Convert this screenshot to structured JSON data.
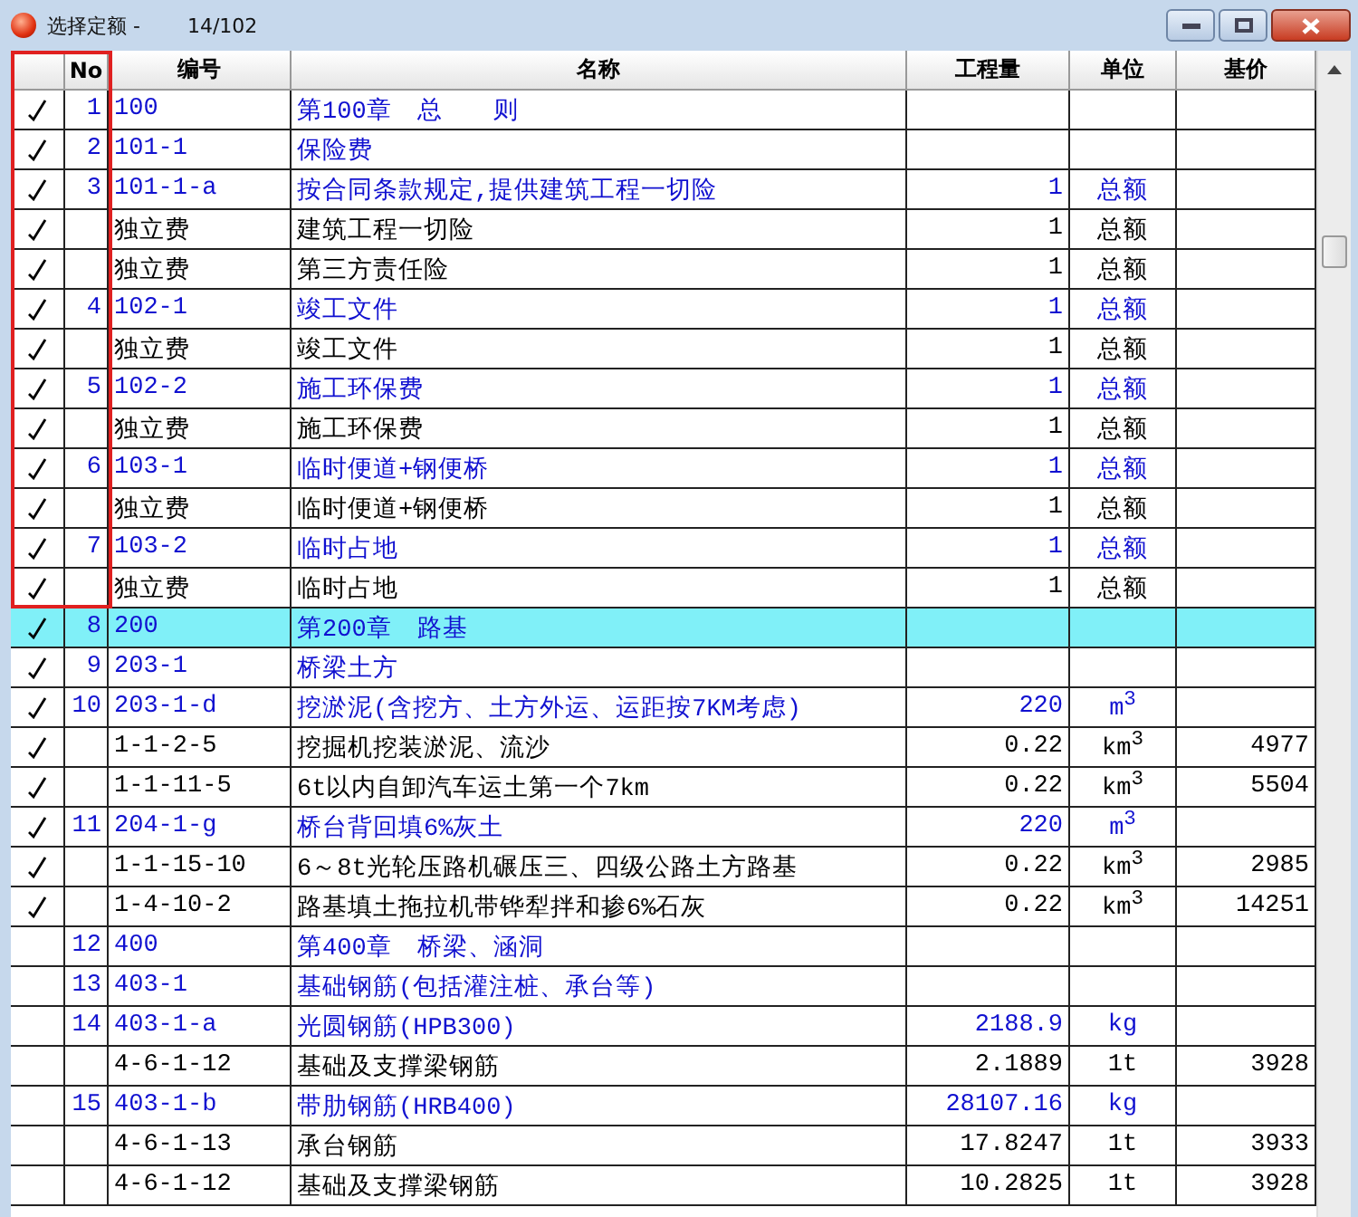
{
  "window": {
    "title": "选择定额 -",
    "counter": "14/102"
  },
  "columns": [
    "No",
    "编号",
    "名称",
    "工程量",
    "单位",
    "基价"
  ],
  "rows": [
    {
      "kind": "chapter",
      "checked": true,
      "framed": true,
      "selected": false,
      "no": "1",
      "code": "100",
      "name": "第100章　总　　则"
    },
    {
      "kind": "chapter",
      "checked": true,
      "framed": true,
      "selected": false,
      "no": "2",
      "code": "101-1",
      "name": "保险费"
    },
    {
      "kind": "chapter",
      "checked": true,
      "framed": true,
      "selected": false,
      "no": "3",
      "code": "101-1-a",
      "name": "按合同条款规定,提供建筑工程一切险",
      "qty": "1",
      "unit": "总额"
    },
    {
      "kind": "item",
      "checked": true,
      "framed": true,
      "selected": false,
      "code": "独立费",
      "name": "建筑工程一切险",
      "qty": "1",
      "unit": "总额"
    },
    {
      "kind": "item",
      "checked": true,
      "framed": true,
      "selected": false,
      "code": "独立费",
      "name": "第三方责任险",
      "qty": "1",
      "unit": "总额"
    },
    {
      "kind": "chapter",
      "checked": true,
      "framed": true,
      "selected": false,
      "no": "4",
      "code": "102-1",
      "name": "竣工文件",
      "qty": "1",
      "unit": "总额"
    },
    {
      "kind": "item",
      "checked": true,
      "framed": true,
      "selected": false,
      "code": "独立费",
      "name": "竣工文件",
      "qty": "1",
      "unit": "总额"
    },
    {
      "kind": "chapter",
      "checked": true,
      "framed": true,
      "selected": false,
      "no": "5",
      "code": "102-2",
      "name": "施工环保费",
      "qty": "1",
      "unit": "总额"
    },
    {
      "kind": "item",
      "checked": true,
      "framed": true,
      "selected": false,
      "code": "独立费",
      "name": "施工环保费",
      "qty": "1",
      "unit": "总额"
    },
    {
      "kind": "chapter",
      "checked": true,
      "framed": true,
      "selected": false,
      "no": "6",
      "code": "103-1",
      "name": "临时便道+钢便桥",
      "qty": "1",
      "unit": "总额"
    },
    {
      "kind": "item",
      "checked": true,
      "framed": true,
      "selected": false,
      "code": "独立费",
      "name": "临时便道+钢便桥",
      "qty": "1",
      "unit": "总额"
    },
    {
      "kind": "chapter",
      "checked": true,
      "framed": true,
      "selected": false,
      "no": "7",
      "code": "103-2",
      "name": "临时占地",
      "qty": "1",
      "unit": "总额"
    },
    {
      "kind": "item",
      "checked": true,
      "framed": true,
      "selected": false,
      "code": "独立费",
      "name": "临时占地",
      "qty": "1",
      "unit": "总额"
    },
    {
      "kind": "chapter",
      "checked": true,
      "framed": false,
      "selected": true,
      "no": "8",
      "code": "200",
      "name": "第200章　路基"
    },
    {
      "kind": "chapter",
      "checked": true,
      "framed": false,
      "selected": false,
      "no": "9",
      "code": "203-1",
      "name": "桥梁土方"
    },
    {
      "kind": "chapter",
      "checked": true,
      "framed": false,
      "selected": false,
      "no": "10",
      "code": "203-1-d",
      "name": "挖淤泥(含挖方、土方外运、运距按7KM考虑)",
      "qty": "220",
      "unit": "m$^{3}$"
    },
    {
      "kind": "item",
      "checked": true,
      "framed": false,
      "selected": false,
      "code": "1-1-2-5",
      "name": "挖掘机挖装淤泥、流沙",
      "qty": "0.22",
      "unit": "km$^{3}$",
      "price": "4977"
    },
    {
      "kind": "item",
      "checked": true,
      "framed": false,
      "selected": false,
      "code": "1-1-11-5",
      "name": "6t以内自卸汽车运土第一个7km",
      "qty": "0.22",
      "unit": "km$^{3}$",
      "price": "5504"
    },
    {
      "kind": "chapter",
      "checked": true,
      "framed": false,
      "selected": false,
      "no": "11",
      "code": "204-1-g",
      "name": "桥台背回填6%灰土",
      "qty": "220",
      "unit": "m$^{3}$"
    },
    {
      "kind": "item",
      "checked": true,
      "framed": false,
      "selected": false,
      "code": "1-1-15-10",
      "name": "6～8t光轮压路机碾压三、四级公路土方路基",
      "qty": "0.22",
      "unit": "km$^{3}$",
      "price": "2985"
    },
    {
      "kind": "item",
      "checked": true,
      "framed": false,
      "selected": false,
      "code": "1-4-10-2",
      "name": "路基填土拖拉机带铧犁拌和掺6%石灰",
      "qty": "0.22",
      "unit": "km$^{3}$",
      "price": "14251"
    },
    {
      "kind": "chapter",
      "checked": false,
      "framed": false,
      "selected": false,
      "no": "12",
      "code": "400",
      "name": "第400章　桥梁、涵洞"
    },
    {
      "kind": "chapter",
      "checked": false,
      "framed": false,
      "selected": false,
      "no": "13",
      "code": "403-1",
      "name": "基础钢筋(包括灌注桩、承台等)"
    },
    {
      "kind": "chapter",
      "checked": false,
      "framed": false,
      "selected": false,
      "no": "14",
      "code": "403-1-a",
      "name": "光圆钢筋(HPB300)",
      "qty": "2188.9",
      "unit": "kg"
    },
    {
      "kind": "item",
      "checked": false,
      "framed": false,
      "selected": false,
      "code": "4-6-1-12",
      "name": "基础及支撑梁钢筋",
      "qty": "2.1889",
      "unit": "1t",
      "price": "3928"
    },
    {
      "kind": "chapter",
      "checked": false,
      "framed": false,
      "selected": false,
      "no": "15",
      "code": "403-1-b",
      "name": "带肋钢筋(HRB400)",
      "qty": "28107.16",
      "unit": "kg"
    },
    {
      "kind": "item",
      "checked": false,
      "framed": false,
      "selected": false,
      "code": "4-6-1-13",
      "name": "承台钢筋",
      "qty": "17.8247",
      "unit": "1t",
      "price": "3933"
    },
    {
      "kind": "item",
      "checked": false,
      "framed": false,
      "selected": false,
      "code": "4-6-1-12",
      "name": "基础及支撑梁钢筋",
      "qty": "10.2825",
      "unit": "1t",
      "price": "3928"
    }
  ]
}
